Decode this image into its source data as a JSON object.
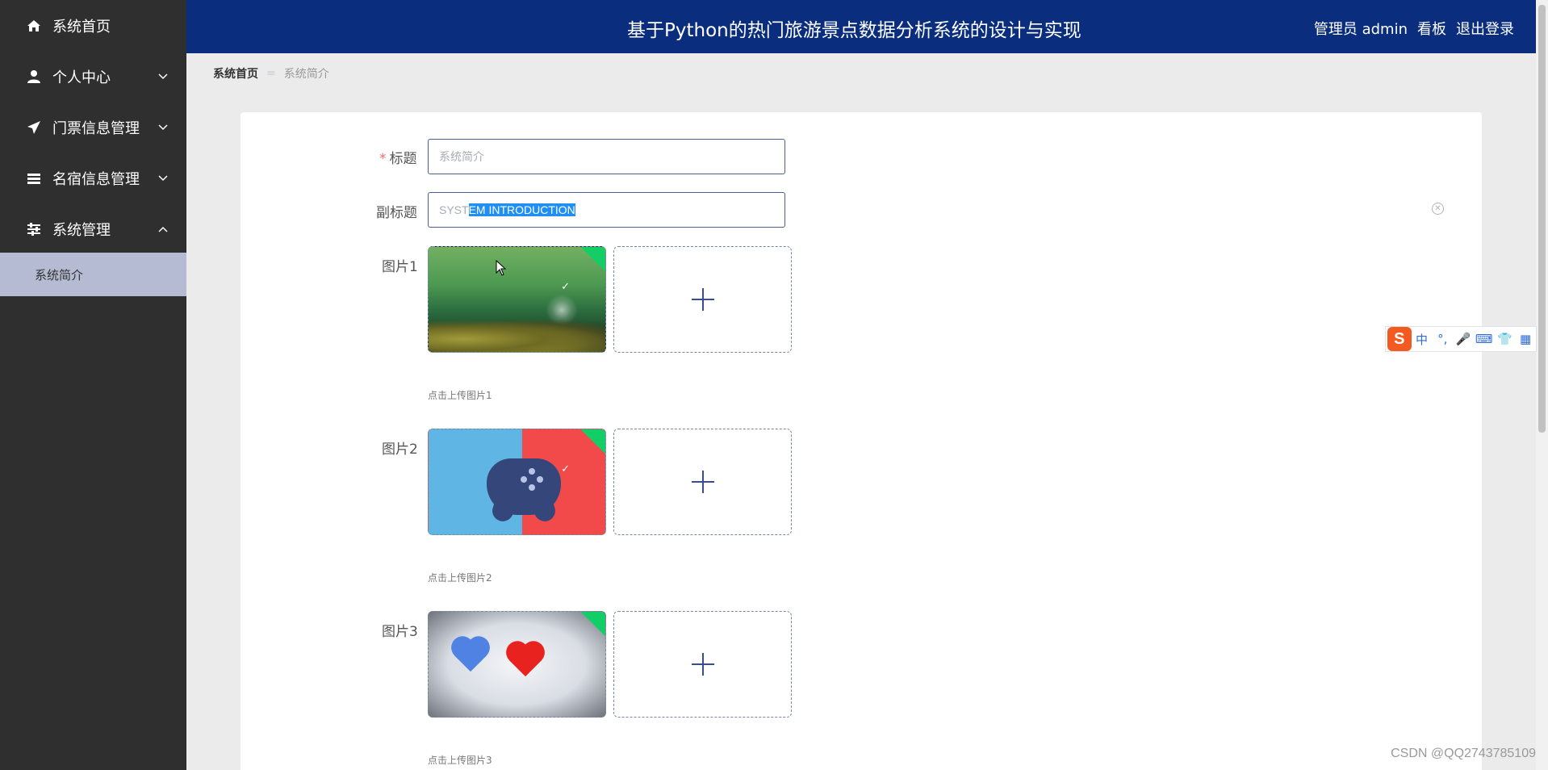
{
  "sidebar": {
    "items": [
      {
        "label": "系统首页",
        "icon": "home-icon",
        "has_arrow": false
      },
      {
        "label": "个人中心",
        "icon": "user-icon",
        "has_arrow": true,
        "arrow": "down"
      },
      {
        "label": "门票信息管理",
        "icon": "paper-plane-icon",
        "has_arrow": true,
        "arrow": "down"
      },
      {
        "label": "名宿信息管理",
        "icon": "list-icon",
        "has_arrow": true,
        "arrow": "down"
      },
      {
        "label": "系统管理",
        "icon": "sliders-icon",
        "has_arrow": true,
        "arrow": "up"
      }
    ],
    "active_sub": {
      "label": "系统简介"
    }
  },
  "header": {
    "title": "基于Python的热门旅游景点数据分析系统的设计与实现",
    "user": "管理员 admin",
    "board": "看板",
    "logout": "退出登录"
  },
  "breadcrumb": {
    "home": "系统首页",
    "separator": "=",
    "current": "系统简介"
  },
  "form": {
    "title_label": "标题",
    "title_required": "*",
    "title_placeholder": "系统简介",
    "subtitle_label": "副标题",
    "subtitle_value_unselected": "SYST",
    "subtitle_value_selected": "EM INTRODUCTION",
    "clear_symbol": "✕",
    "images": [
      {
        "label": "图片1",
        "tip": "点击上传图片1",
        "content": "green nature dandelion photo"
      },
      {
        "label": "图片2",
        "tip": "点击上传图片2",
        "content": "gamepad illustration"
      },
      {
        "label": "图片3",
        "tip": "点击上传图片3",
        "content": "blue and red hearts photo"
      }
    ],
    "upload_icon": "plus-icon"
  },
  "ime": {
    "logo": "S",
    "items": [
      "中",
      "°,",
      "🎤",
      "⌨",
      "👕",
      "▦"
    ]
  },
  "watermark": "CSDN @QQ2743785109",
  "colors": {
    "sidebar_bg": "#2f2f2f",
    "header_bg": "#0a2d7d",
    "active_sub_bg": "#b4bbd3",
    "success_corner": "#13ce66",
    "selection": "#1f8ff6"
  }
}
